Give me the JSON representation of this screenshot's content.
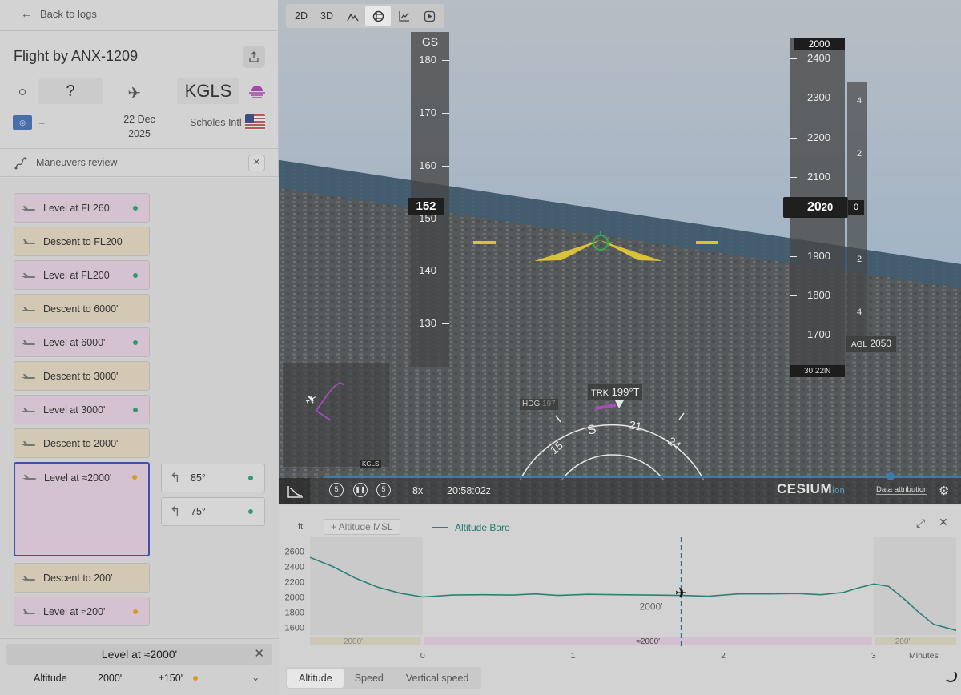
{
  "sidebar": {
    "back_label": "Back to logs",
    "flight_title": "Flight by ANX-1209",
    "origin_code": "?",
    "route_sep": "–",
    "dest_code": "KGLS",
    "origin_name": "–",
    "date_line1": "22 Dec",
    "date_line2": "2025",
    "dest_name": "Scholes Intl",
    "maneuvers_title": "Maneuvers review",
    "maneuvers": [
      {
        "label": "Level at FL260",
        "kind": "level",
        "status": "green"
      },
      {
        "label": "Descent to FL200",
        "kind": "descent",
        "status": ""
      },
      {
        "label": "Level at FL200",
        "kind": "level",
        "status": "green"
      },
      {
        "label": "Descent to 6000'",
        "kind": "descent",
        "status": ""
      },
      {
        "label": "Level at 6000'",
        "kind": "level",
        "status": "green"
      },
      {
        "label": "Descent to 3000'",
        "kind": "descent",
        "status": ""
      },
      {
        "label": "Level at 3000'",
        "kind": "level",
        "status": "green"
      },
      {
        "label": "Descent to 2000'",
        "kind": "descent",
        "status": ""
      },
      {
        "label": "Level at ≈2000'",
        "kind": "level",
        "status": "orange",
        "selected": true
      },
      {
        "label": "Descent to 200'",
        "kind": "descent",
        "status": ""
      },
      {
        "label": "Level at ≈200'",
        "kind": "level",
        "status": "orange"
      }
    ],
    "turns": [
      {
        "label": "85°",
        "status": "green"
      },
      {
        "label": "75°",
        "status": "green"
      }
    ],
    "detail": {
      "title": "Level at ≈2000'",
      "param": "Altitude",
      "value": "2000'",
      "tolerance": "±150'"
    }
  },
  "view": {
    "tools": [
      "2D",
      "3D"
    ],
    "speed": {
      "label": "GS",
      "current": "152",
      "ticks": [
        "180",
        "170",
        "160",
        "150",
        "140",
        "130"
      ]
    },
    "altitude": {
      "selected": "2000",
      "current_big": "20",
      "current_small": "20",
      "ticks": [
        "2400",
        "2300",
        "2200",
        "2100",
        "1900",
        "1800",
        "1700"
      ],
      "baro": "30.22",
      "baro_unit": "IN",
      "agl_label": "AGL",
      "agl_value": "2050"
    },
    "vs": {
      "current": "0",
      "ticks": [
        "4",
        "2",
        "2",
        "4"
      ]
    },
    "track": {
      "label": "TRK",
      "value": "199°T"
    },
    "hdg_label": "HDG",
    "hdg_value": "197",
    "compass": [
      "15",
      "S",
      "21",
      "24"
    ],
    "minimap_label": "KGLS",
    "playback": {
      "multiplier": "8x",
      "time": "20:58:02z",
      "replay_back": "5",
      "replay_fwd": "5",
      "progress": 0.89
    },
    "brand": "CESIUM",
    "brand_suffix": "ion",
    "attribution": "Data attribution"
  },
  "chart": {
    "unit": "ft",
    "msl_button": "+ Altitude MSL",
    "legend": "Altitude Baro",
    "tabs": [
      "Altitude",
      "Speed",
      "Vertical speed"
    ],
    "active_tab": "Altitude",
    "x_unit": "Minutes",
    "band_labels": [
      "2000'",
      "≈2000'",
      "200'"
    ],
    "ref_label": "2000'"
  },
  "chart_data": {
    "type": "line",
    "xlabel": "Minutes",
    "ylabel": "ft",
    "xlim": [
      -0.75,
      3.55
    ],
    "ylim": [
      1500,
      2700
    ],
    "xticks": [
      0,
      1,
      2,
      3
    ],
    "yticks": [
      1600,
      1800,
      2000,
      2200,
      2400,
      2600
    ],
    "series": [
      {
        "name": "Altitude Baro",
        "x": [
          -0.75,
          -0.6,
          -0.45,
          -0.3,
          -0.15,
          0,
          0.2,
          0.4,
          0.6,
          0.75,
          0.9,
          1.1,
          1.3,
          1.5,
          1.72,
          1.9,
          2.1,
          2.3,
          2.5,
          2.65,
          2.8,
          2.9,
          3.0,
          3.1,
          3.2,
          3.3,
          3.4,
          3.55
        ],
        "y": [
          2520,
          2400,
          2250,
          2130,
          2050,
          2000,
          2025,
          2030,
          2025,
          2040,
          2020,
          2035,
          2030,
          2025,
          2020,
          2010,
          2040,
          2040,
          2045,
          2030,
          2060,
          2120,
          2170,
          2140,
          1980,
          1800,
          1640,
          1560
        ]
      }
    ],
    "reference_line": 2000,
    "current_x": 1.72
  }
}
